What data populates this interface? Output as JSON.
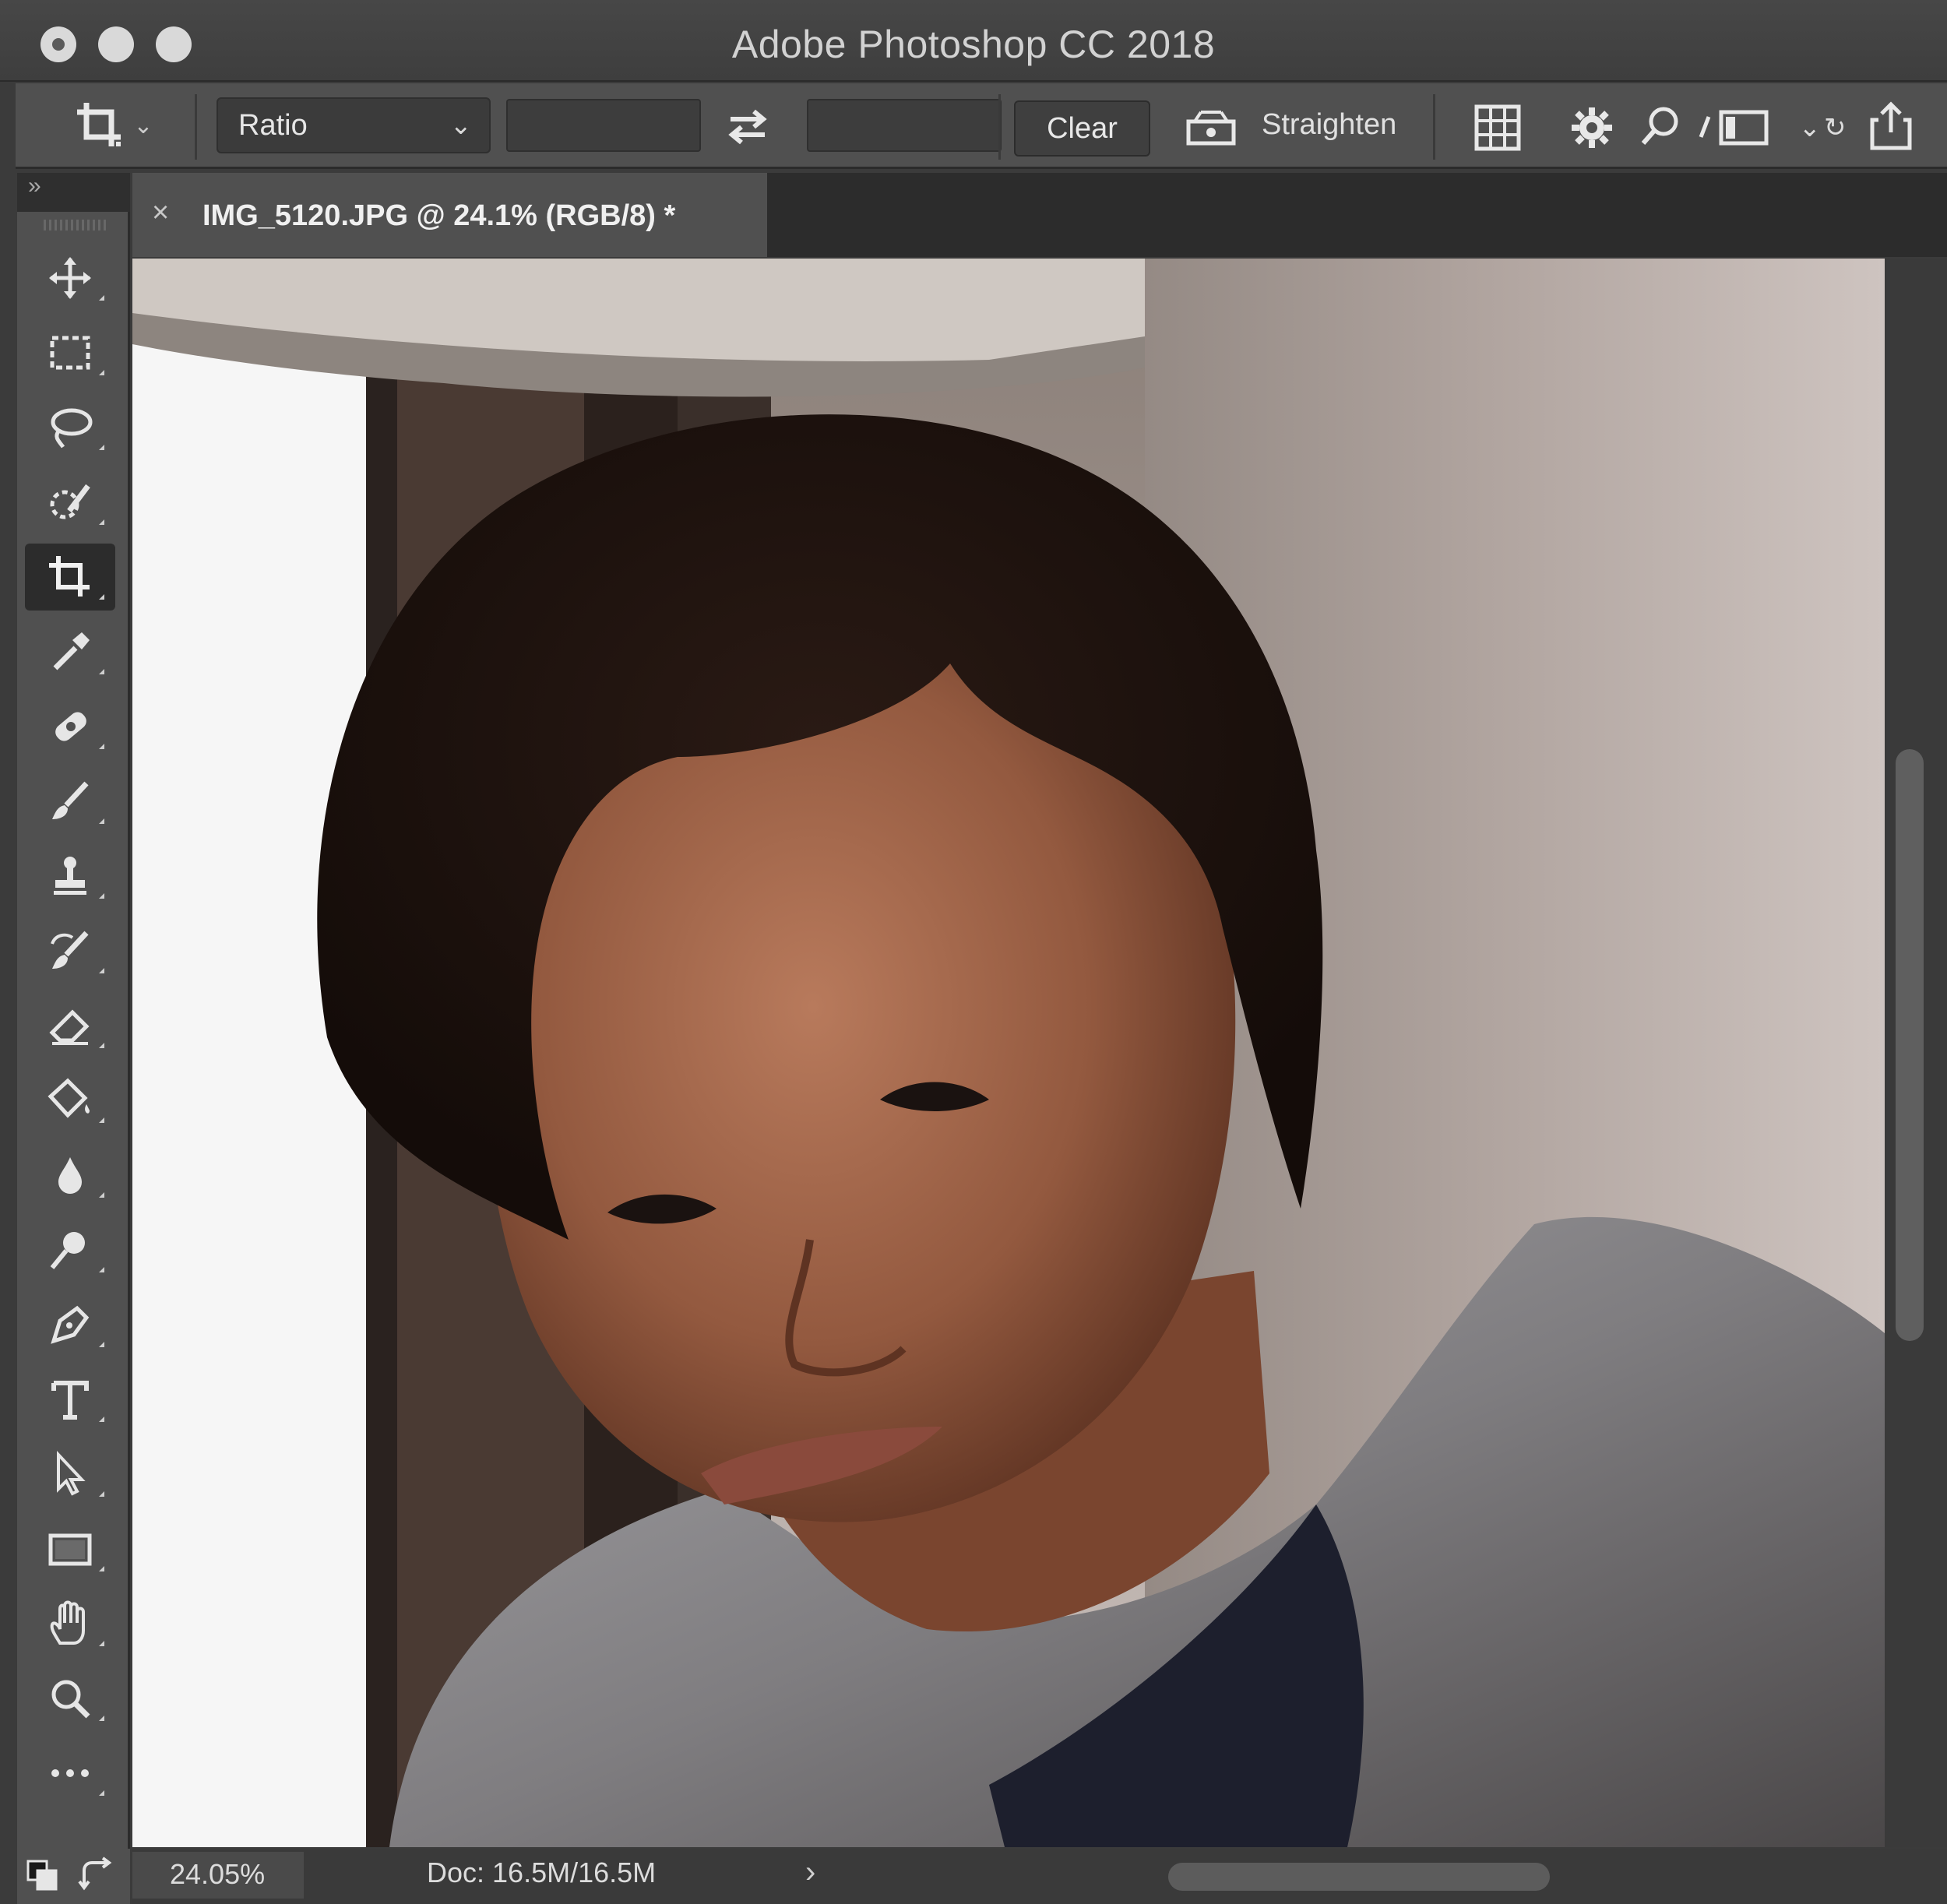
{
  "window": {
    "title": "Adobe Photoshop CC 2018"
  },
  "options_bar": {
    "tool_icon": "crop-icon",
    "ratio_select": {
      "value": "Ratio"
    },
    "width_field": {
      "value": ""
    },
    "height_field": {
      "value": ""
    },
    "swap_icon": "swap-arrows-icon",
    "clear_label": "Clear",
    "straighten_icon": "level-icon",
    "straighten_label": "Straighten",
    "overlay_icon": "grid-overlay-icon",
    "settings_icon": "gear-icon",
    "search_icon": "search-icon",
    "workspace_icon": "workspace-layout-icon",
    "share_icon": "share-icon"
  },
  "document_tab": {
    "close_glyph": "×",
    "name": "IMG_5120.JPG @ 24.1% (RGB/8) *"
  },
  "toolbar": {
    "collapse_glyph": "»",
    "tools": [
      {
        "name": "move-tool",
        "icon": "move-icon"
      },
      {
        "name": "marquee-tool",
        "icon": "rectangular-marquee-icon"
      },
      {
        "name": "lasso-tool",
        "icon": "lasso-icon"
      },
      {
        "name": "quick-selection-tool",
        "icon": "quick-selection-icon"
      },
      {
        "name": "crop-tool",
        "icon": "crop-icon",
        "active": true
      },
      {
        "name": "eyedropper-tool",
        "icon": "eyedropper-icon"
      },
      {
        "name": "healing-brush-tool",
        "icon": "bandage-icon"
      },
      {
        "name": "brush-tool",
        "icon": "brush-icon"
      },
      {
        "name": "clone-stamp-tool",
        "icon": "stamp-icon"
      },
      {
        "name": "history-brush-tool",
        "icon": "history-brush-icon"
      },
      {
        "name": "eraser-tool",
        "icon": "eraser-icon"
      },
      {
        "name": "paint-bucket-tool",
        "icon": "paint-bucket-icon"
      },
      {
        "name": "blur-tool",
        "icon": "drop-icon"
      },
      {
        "name": "dodge-tool",
        "icon": "dodge-icon"
      },
      {
        "name": "pen-tool",
        "icon": "pen-icon"
      },
      {
        "name": "type-tool",
        "icon": "type-icon"
      },
      {
        "name": "path-selection-tool",
        "icon": "arrow-cursor-icon"
      },
      {
        "name": "rectangle-tool",
        "icon": "rectangle-icon"
      },
      {
        "name": "hand-tool",
        "icon": "hand-icon"
      },
      {
        "name": "zoom-tool",
        "icon": "zoom-icon"
      },
      {
        "name": "more-tools",
        "icon": "ellipsis-icon"
      }
    ],
    "bottom": {
      "default_colors_icon": "default-colors-icon",
      "swap_colors_icon": "swap-colors-icon"
    }
  },
  "status_bar": {
    "zoom": "24.05%",
    "doc_info": "Doc: 16.5M/16.5M",
    "arrow_glyph": "›"
  }
}
